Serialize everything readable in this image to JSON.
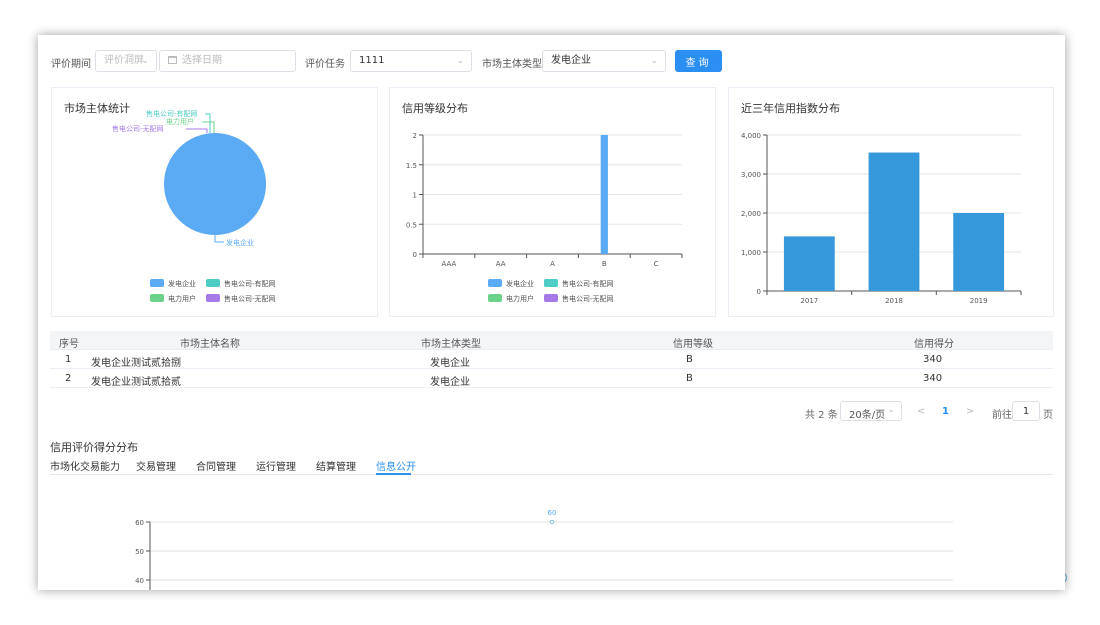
{
  "filters": {
    "period_label": "评价期间",
    "period_placeholder": "评价洞屏",
    "date_placeholder": "选择日期",
    "task_label": "评价任务",
    "task_value": "1111",
    "type_label": "市场主体类型",
    "type_value": "发电企业",
    "query_button": "查询"
  },
  "cards": {
    "stats_title": "市场主体统计",
    "grade_title": "信用等级分布",
    "index_title": "近三年信用指数分布"
  },
  "legend": {
    "items": [
      "发电企业",
      "售电公司-有配网",
      "电力用户",
      "售电公司-无配网"
    ]
  },
  "colors": {
    "blue": "#5aabf4",
    "teal": "#4ecdc4",
    "green": "#6cd18b",
    "purple": "#a57ae6",
    "bar2": "#3498db",
    "accent": "#2a8ef2"
  },
  "pie_labels": [
    "售电公司-有配网",
    "电力用户",
    "售电公司-无配网",
    "发电企业"
  ],
  "chart_data": [
    {
      "type": "pie",
      "title": "市场主体统计",
      "labels": [
        "发电企业",
        "售电公司-有配网",
        "电力用户",
        "售电公司-无配网"
      ],
      "values": [
        2,
        0,
        0,
        0
      ],
      "legend": "bottom"
    },
    {
      "type": "bar",
      "title": "信用等级分布",
      "categories": [
        "AAA",
        "AA",
        "A",
        "B",
        "C"
      ],
      "values": [
        0,
        0,
        0,
        2,
        0
      ],
      "yticks": [
        "0",
        "0.5",
        "1",
        "1.5",
        "2"
      ],
      "ylim": [
        0,
        2
      ],
      "grid": true,
      "legend": "bottom"
    },
    {
      "type": "bar",
      "title": "近三年信用指数分布",
      "categories": [
        "2017",
        "2018",
        "2019"
      ],
      "values": [
        1400,
        3550,
        2000
      ],
      "yticks": [
        "0",
        "1,000",
        "2,000",
        "3,000",
        "4,000"
      ],
      "ylim": [
        0,
        4000
      ],
      "grid": true
    },
    {
      "type": "line",
      "title": "信用评价得分分布",
      "categories": [
        "信息公开"
      ],
      "values": [
        60
      ],
      "data_label": "60",
      "yticks": [
        "60",
        "50",
        "40"
      ],
      "grid": true
    }
  ],
  "table": {
    "headers": [
      "序号",
      "市场主体名称",
      "市场主体类型",
      "信用等级",
      "信用得分"
    ],
    "rows": [
      [
        "1",
        "发电企业测试贰拾捌",
        "发电企业",
        "B",
        "340"
      ],
      [
        "2",
        "发电企业测试贰拾贰",
        "发电企业",
        "B",
        "340"
      ]
    ]
  },
  "pagination": {
    "total": "共 2 条",
    "page_size": "20条/页",
    "prev": "<",
    "current": "1",
    "next": ">",
    "goto_label": "前往",
    "goto_value": "1",
    "page_unit": "页"
  },
  "section2": {
    "title": "信用评价得分分布",
    "tabs": [
      "市场化交易能力",
      "交易管理",
      "合同管理",
      "运行管理",
      "结算管理",
      "信息公开"
    ],
    "active_tab": 5
  }
}
